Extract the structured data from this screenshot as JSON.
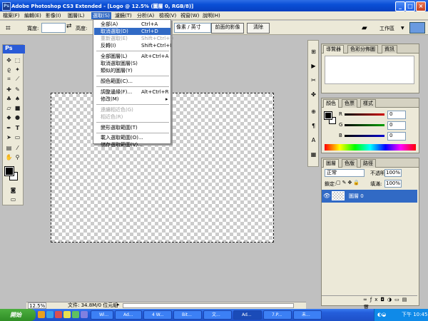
{
  "window": {
    "title": "Adobe Photoshop CS3 Extended - [Logo @ 12.5% (圖層 0, RGB/8)]",
    "buttons": [
      "_",
      "□",
      "×"
    ]
  },
  "menubar": [
    "檔案(F)",
    "編輯(E)",
    "影像(I)",
    "圖層(L)",
    "選取(S)",
    "濾鏡(T)",
    "分析(A)",
    "檢視(V)",
    "視窗(W)",
    "說明(H)"
  ],
  "options": {
    "width_label": "寬度:",
    "height_label": "高度:",
    "resolution_unit": "像素 / 英寸",
    "front_image_button": "前面的影像",
    "clear_button": "清除",
    "workspace_label": "工作區"
  },
  "select_menu": [
    {
      "label": "全部(A)",
      "shortcut": "Ctrl+A",
      "state": "normal"
    },
    {
      "label": "取消選取(D)",
      "shortcut": "Ctrl+D",
      "state": "highlight"
    },
    {
      "label": "重新選取(E)",
      "shortcut": "Shift+Ctrl+D",
      "state": "disabled"
    },
    {
      "label": "反轉(I)",
      "shortcut": "Shift+Ctrl+I",
      "state": "normal"
    },
    {
      "label": "全部圖層(L)",
      "shortcut": "Alt+Ctrl+A",
      "state": "normal"
    },
    {
      "label": "取消選取圖層(S)",
      "shortcut": "",
      "state": "normal"
    },
    {
      "label": "類似的圖層(Y)",
      "shortcut": "",
      "state": "normal"
    },
    {
      "label": "顏色範圍(C)...",
      "shortcut": "",
      "state": "normal"
    },
    {
      "label": "調整邊緣(F)...",
      "shortcut": "Alt+Ctrl+R",
      "state": "normal"
    },
    {
      "label": "修改(M)",
      "shortcut": "",
      "state": "submenu"
    },
    {
      "label": "連續相近色(G)",
      "shortcut": "",
      "state": "disabled"
    },
    {
      "label": "相近色(R)",
      "shortcut": "",
      "state": "disabled"
    },
    {
      "label": "變形選取範圍(T)",
      "shortcut": "",
      "state": "normal"
    },
    {
      "label": "載入選取範圍(O)...",
      "shortcut": "",
      "state": "normal"
    },
    {
      "label": "儲存選取範圍(V)...",
      "shortcut": "",
      "state": "normal"
    }
  ],
  "toolbox": {
    "logo": "Ps"
  },
  "navigator_panel": {
    "tabs": [
      "導覽器",
      "色彩分佈圖",
      "資訊"
    ]
  },
  "color_panel": {
    "tabs": [
      "顏色",
      "色票",
      "樣式"
    ],
    "channels": [
      {
        "label": "R",
        "value": "0",
        "color": "#d00000"
      },
      {
        "label": "G",
        "value": "0",
        "color": "#00a000"
      },
      {
        "label": "B",
        "value": "0",
        "color": "#0000d0"
      }
    ]
  },
  "layers_panel": {
    "tabs": [
      "圖層",
      "色版",
      "路徑"
    ],
    "blend_mode": "正常",
    "opacity_label": "不透明:",
    "opacity_value": "100%",
    "lock_label": "鎖定:",
    "fill_label": "填滿:",
    "fill_value": "100%",
    "layer_name": "圖層 0"
  },
  "status": {
    "zoom": "12.5%",
    "doc_info": "文件: 34.8M/0 位元組"
  },
  "taskbar": {
    "start_label": "開始",
    "items": [
      "Wi...",
      "Ad...",
      "4 W...",
      "Bit...",
      "文...",
      "Ad...",
      "7.P...",
      "未..."
    ],
    "clock": "下午 10:45"
  }
}
